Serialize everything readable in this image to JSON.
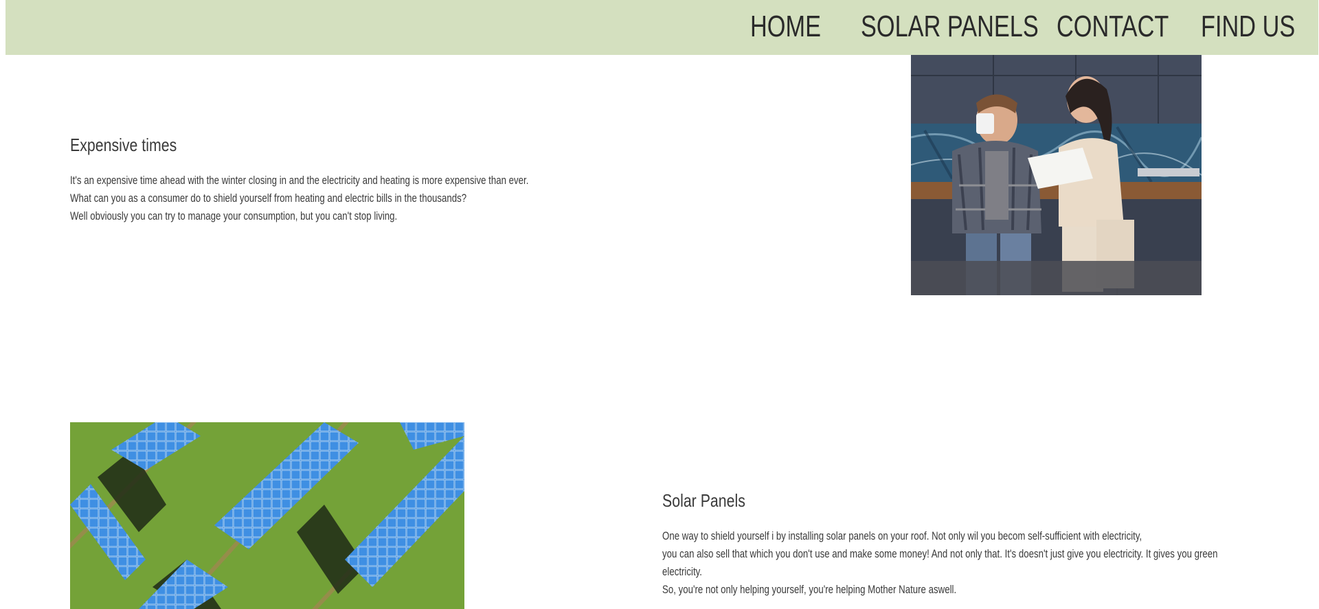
{
  "nav": {
    "items": [
      {
        "label": "HOME"
      },
      {
        "label": "SOLAR PANELS"
      },
      {
        "label": "CONTACT"
      },
      {
        "label": "FIND US"
      }
    ]
  },
  "section1": {
    "title": "Expensive times",
    "lines": [
      "It's an expensive time ahead with the winter closing in and the electricity and heating is more expensive than ever.",
      "What can you as a consumer do to shield yourself from heating and electric bills in the thousands?",
      "Well obviously you can try to manage your consumption, but you can't stop living."
    ],
    "image": "couple-reviewing-bills-photo"
  },
  "section2": {
    "title": "Solar Panels",
    "lines": [
      "One way to shield yourself i by installing solar panels on your roof. Not only wil you becom self-sufficient with electricity,",
      "you can also sell that which you don't use and make some money! And not only that. It's doesn't just give you electricity. It gives you green",
      "electricity.",
      "So, you're not only helping yourself, you're helping Mother Nature aswell."
    ],
    "image": "aerial-solar-panels-photo"
  },
  "colors": {
    "navbar_bg": "#d4e0bf",
    "text": "#3a3a3a"
  }
}
